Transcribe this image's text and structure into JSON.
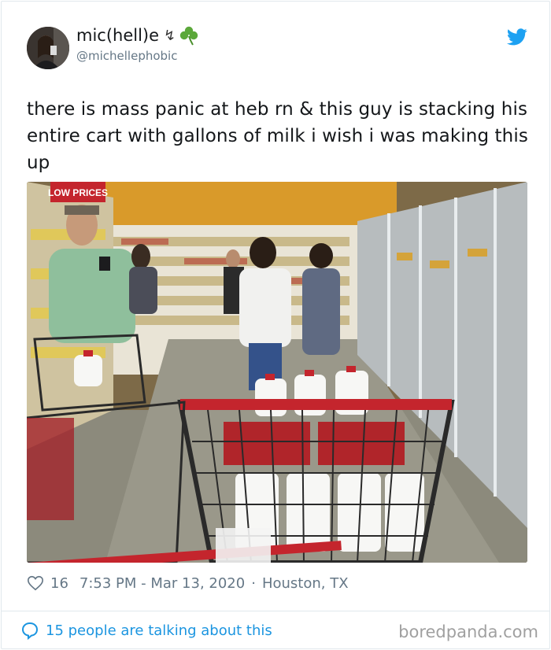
{
  "user": {
    "display_name": "mic(hell)e",
    "name_symbols": "↯ ☘",
    "handle": "@michellephobic"
  },
  "tweet": {
    "text": "there is mass panic at heb rn & this guy is stacking his entire cart with gallons of milk i wish i was making this up"
  },
  "photo": {
    "sign_text": "LOW PRICES",
    "description_colors": {
      "wall": "#d99a2a",
      "floor": "#8c8a7c",
      "cart": "#2a2a2a",
      "cart_red": "#c4252d"
    }
  },
  "meta": {
    "likes": "16",
    "datetime": "7:53 PM - Mar 13, 2020",
    "separator": "·",
    "location": "Houston, TX"
  },
  "footer": {
    "talking": "15 people are talking about this",
    "watermark": "boredpanda.com"
  },
  "colors": {
    "twitter_blue": "#1da1f2",
    "link_blue": "#1b95e0",
    "muted": "#657786"
  }
}
